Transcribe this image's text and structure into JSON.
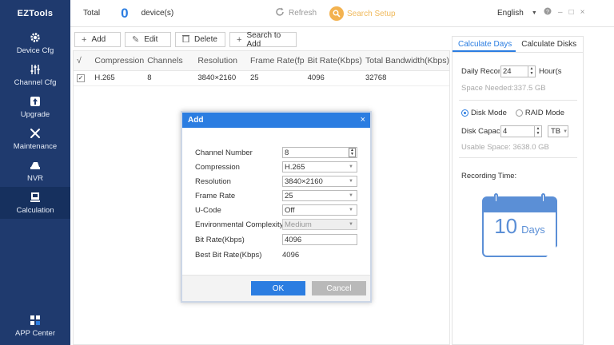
{
  "sidebar": {
    "logo": "EZTools",
    "items": [
      {
        "label": "Device Cfg",
        "icon": "gear-icon"
      },
      {
        "label": "Channel Cfg",
        "icon": "sliders-icon"
      },
      {
        "label": "Upgrade",
        "icon": "upgrade-icon"
      },
      {
        "label": "Maintenance",
        "icon": "tools-icon"
      },
      {
        "label": "NVR",
        "icon": "nvr-icon"
      },
      {
        "label": "Calculation",
        "icon": "calculator-icon"
      }
    ],
    "app_center": "APP Center",
    "active_item": "Calculation"
  },
  "topbar": {
    "total_label": "Total",
    "total_count": "0",
    "device_label": "device(s)",
    "refresh": "Refresh",
    "search_setup": "Search Setup",
    "language": "English",
    "help_icon": "help-icon",
    "minimize": "–",
    "maximize": "□",
    "close": "×"
  },
  "toolbar": {
    "add": "Add",
    "edit": "Edit",
    "delete": "Delete",
    "search_to_add": "Search to Add"
  },
  "table": {
    "columns": [
      "√",
      "Compression",
      "Channels",
      "Resolution",
      "Frame Rate(fp",
      "Bit Rate(Kbps)",
      "Total Bandwidth(Kbps)"
    ],
    "rows": [
      {
        "checked": true,
        "compression": "H.265",
        "channels": "8",
        "resolution": "3840×2160",
        "frame_rate": "25",
        "bit_rate": "4096",
        "total_bandwidth": "32768"
      }
    ]
  },
  "right_panel": {
    "tabs": [
      "Calculate Days",
      "Calculate Disks"
    ],
    "active_tab": "Calculate Days",
    "daily_record_label": "Daily Recor",
    "daily_record_value": "24",
    "hours_unit": "Hour(s",
    "space_needed": "Space Needed:337.5 GB",
    "disk_mode": "Disk Mode",
    "raid_mode": "RAID Mode",
    "disk_capacity_label": "Disk Capac",
    "disk_capacity_value": "4",
    "disk_unit": "TB",
    "usable_space": "Usable Space: 3638.0 GB",
    "recording_time_label": "Recording Time:",
    "recording_days": "10",
    "days_unit": "Days"
  },
  "modal": {
    "title": "Add",
    "fields": [
      {
        "label": "Channel Number",
        "value": "8"
      },
      {
        "label": "Compression",
        "value": "H.265"
      },
      {
        "label": "Resolution",
        "value": "3840×2160"
      },
      {
        "label": "Frame Rate",
        "value": "25"
      },
      {
        "label": "U-Code",
        "value": "Off"
      },
      {
        "label": "Environmental Complexity",
        "value": "Medium"
      },
      {
        "label": "Bit Rate(Kbps)",
        "value": "4096"
      },
      {
        "label": "Best Bit Rate(Kbps)",
        "value": "4096"
      }
    ],
    "ok": "OK",
    "cancel": "Cancel"
  },
  "colors": {
    "sidebar_bg": "#1f3a6e",
    "accent": "#2b7de1",
    "search_setup": "#f3b24f"
  }
}
